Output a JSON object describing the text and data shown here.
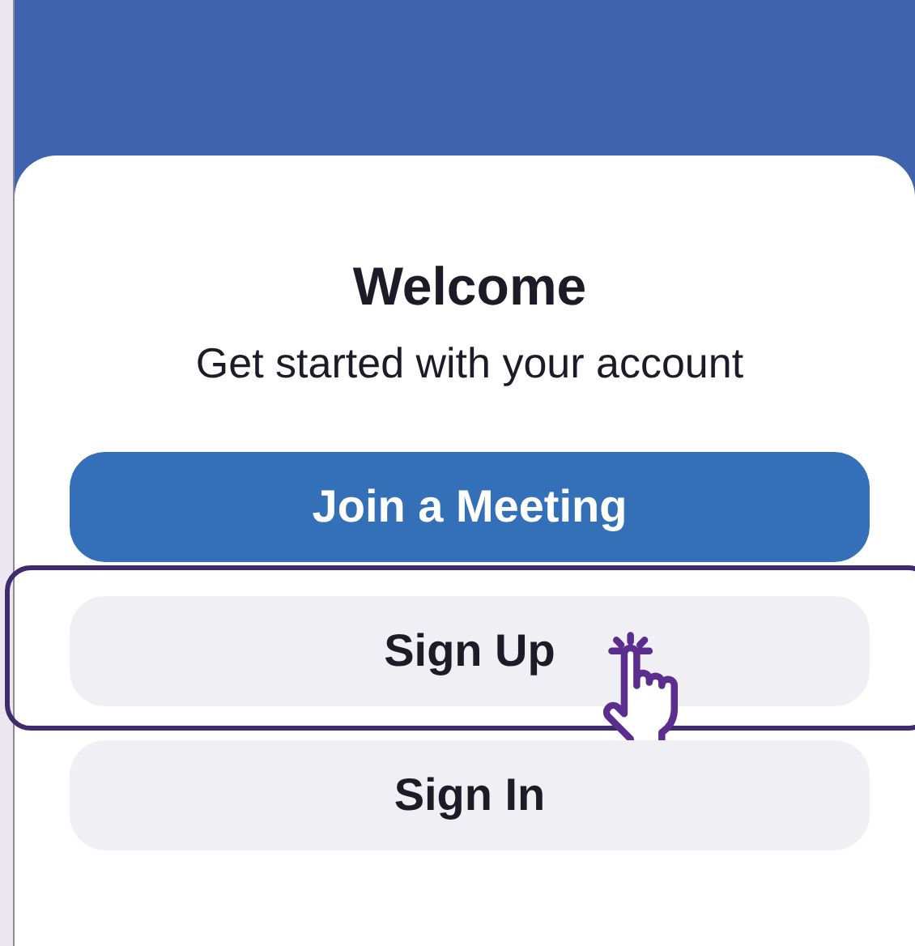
{
  "card": {
    "title": "Welcome",
    "subtitle": "Get started with your account"
  },
  "buttons": [
    {
      "label": "Join a Meeting",
      "kind": "primary",
      "highlighted": false
    },
    {
      "label": "Sign Up",
      "kind": "secondary",
      "highlighted": true
    },
    {
      "label": "Sign In",
      "kind": "secondary",
      "highlighted": false
    }
  ]
}
